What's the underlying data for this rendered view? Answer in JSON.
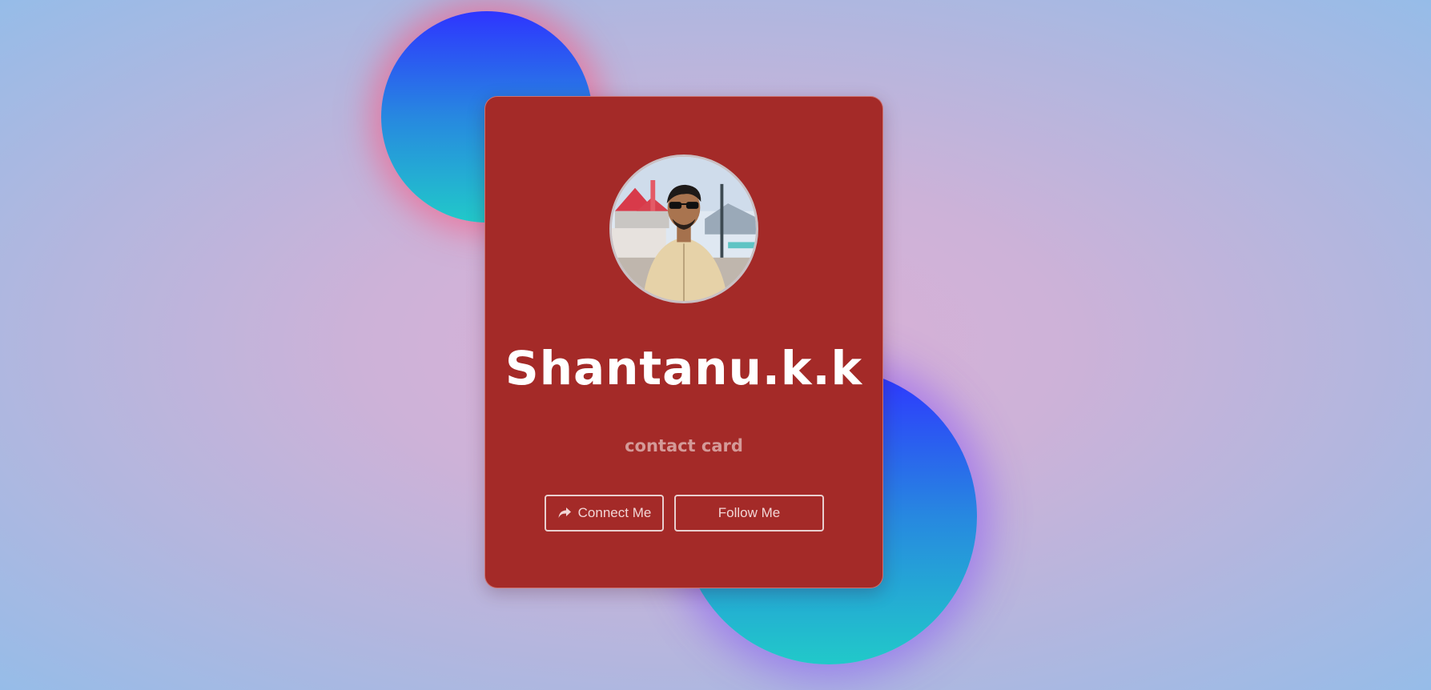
{
  "card": {
    "name": "Shantanu.k.k",
    "subtitle": "contact card",
    "avatar_alt": "profile photo",
    "buttons": {
      "connect_label": "Connect Me",
      "connect_icon": "share-icon",
      "follow_label": "Follow Me"
    }
  },
  "colors": {
    "card_background": "#a42a28",
    "blob_gradient_top": "#2e35ff",
    "blob_gradient_bottom": "#21c9c9",
    "name_text": "#ffffff",
    "subtitle_text": "#d49a98"
  }
}
